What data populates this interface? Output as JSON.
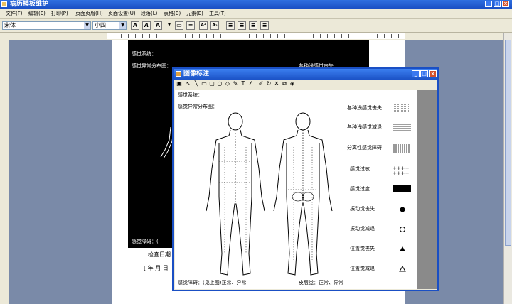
{
  "app": {
    "title": "病历模板维护"
  },
  "menu": [
    "文件(F)",
    "编辑(E)",
    "打印(P)",
    "页面页眉(H)",
    "页面设置(U)",
    "段落(L)",
    "表格(B)",
    "元素(E)",
    "工具(T)"
  ],
  "toolbar": {
    "font": "宋体",
    "size": "小四",
    "bold": "A",
    "italic": "A",
    "underline": "A",
    "superscript": "A²",
    "subscript": "A₂"
  },
  "document": {
    "section": "感觉系统：",
    "map_label": "感觉异常分布图：",
    "partial_legend": "各种浅感觉丧失",
    "disorder_line": "感觉障碍：(",
    "check_date": "检查日期",
    "date_line": "[ 年 月 日"
  },
  "dialog": {
    "title": "图像标注",
    "canvas": {
      "section": "感觉系统：",
      "map_label": "感觉异常分布图：",
      "legend": [
        "各种浅感觉丧失",
        "各种浅感觉减退",
        "分离性感觉障碍",
        "感觉过敏",
        "感觉过度",
        "振动觉丧失",
        "振动觉减退",
        "位置觉丧失",
        "位置觉减退"
      ],
      "disorder": "感觉障碍：(见上图)正常、异常",
      "skin": "皮层觉：正常、异常"
    }
  }
}
